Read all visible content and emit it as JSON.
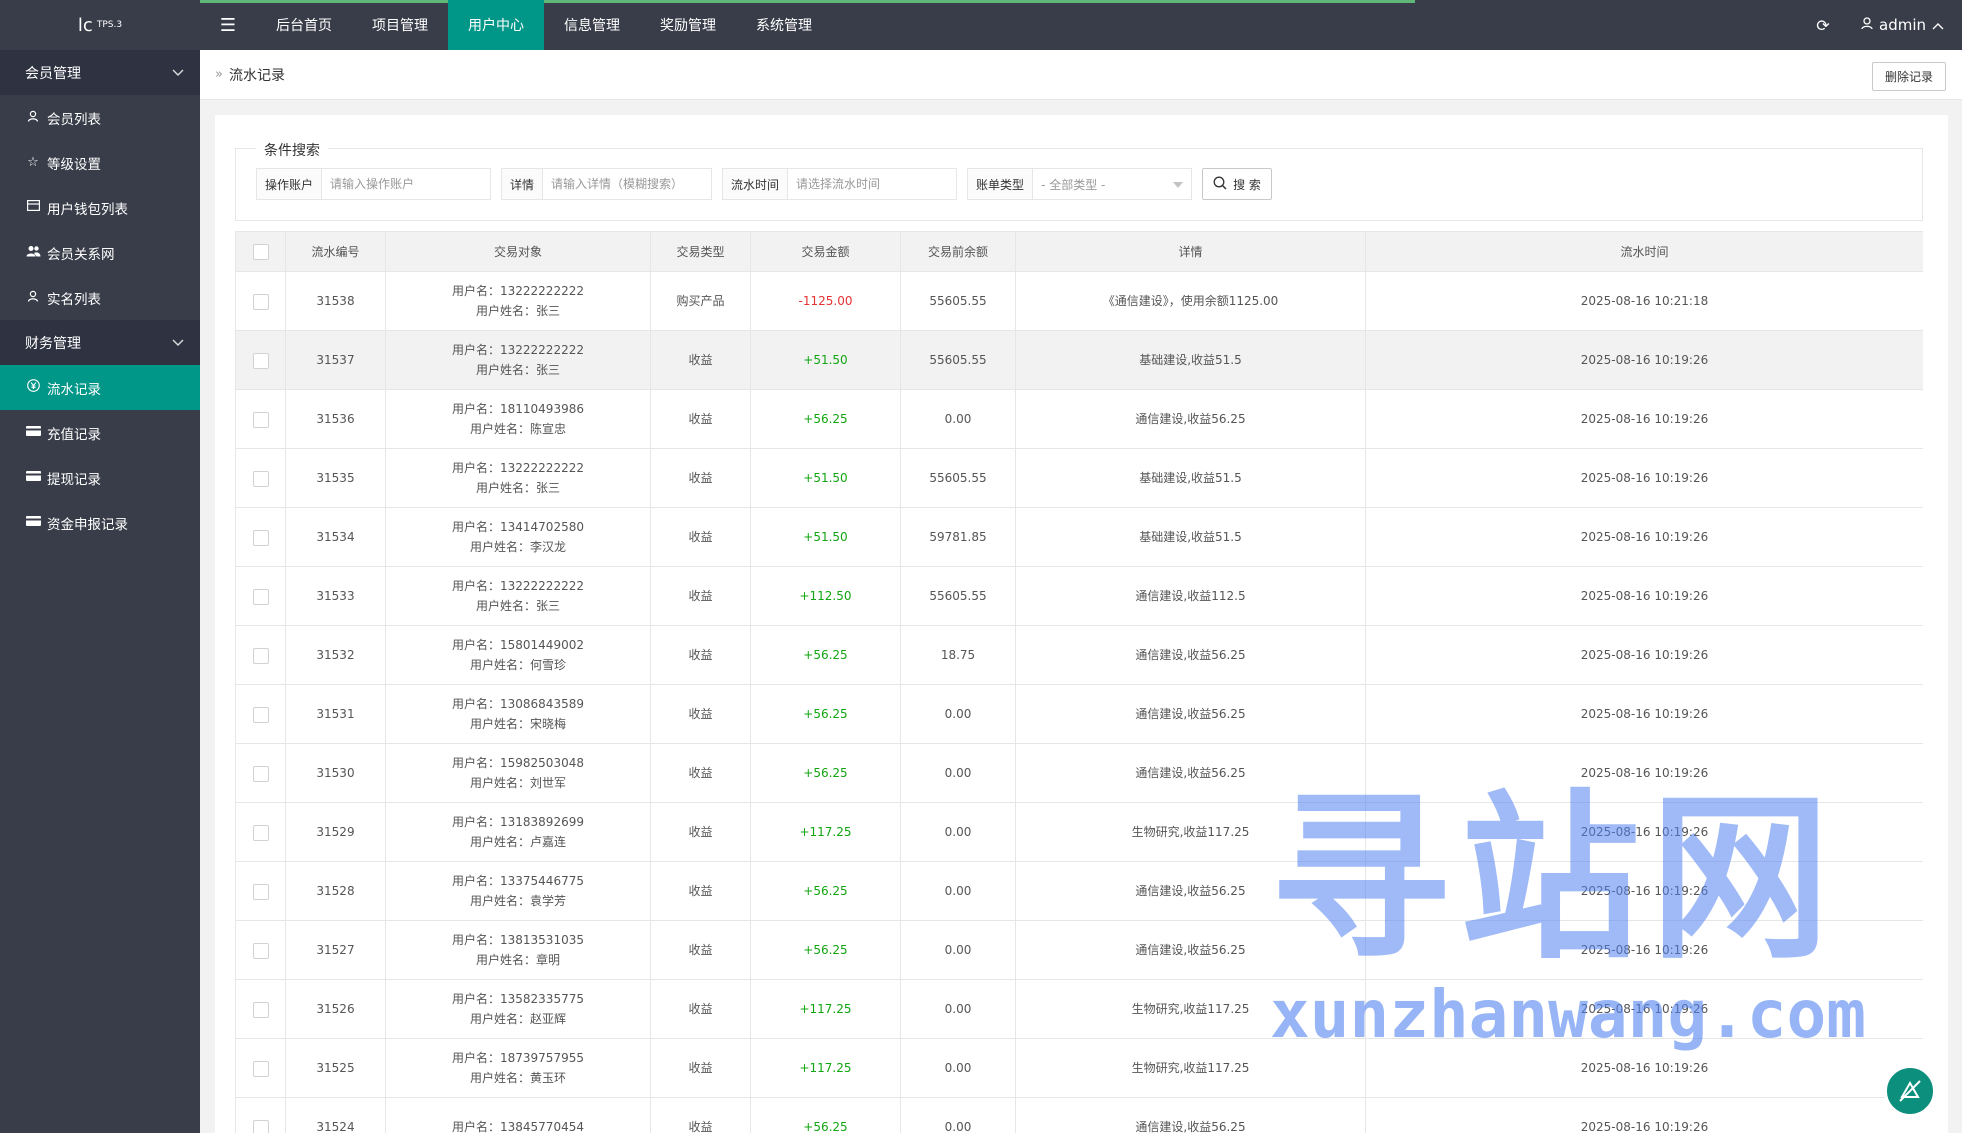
{
  "app": {
    "logo_text": "lc",
    "logo_version": "TPS.3",
    "admin_label": "admin"
  },
  "topnav": [
    {
      "label": "后台首页",
      "active": false
    },
    {
      "label": "项目管理",
      "active": false
    },
    {
      "label": "用户中心",
      "active": true
    },
    {
      "label": "信息管理",
      "active": false
    },
    {
      "label": "奖励管理",
      "active": false
    },
    {
      "label": "系统管理",
      "active": false
    }
  ],
  "sidebar": {
    "group1": "会员管理",
    "group1_items": [
      {
        "label": "会员列表",
        "icon": "user-icon"
      },
      {
        "label": "等级设置",
        "icon": "star-icon"
      },
      {
        "label": "用户钱包列表",
        "icon": "wallet-icon"
      },
      {
        "label": "会员关系网",
        "icon": "users-icon"
      },
      {
        "label": "实名列表",
        "icon": "user-icon"
      }
    ],
    "group2": "财务管理",
    "group2_items": [
      {
        "label": "流水记录",
        "icon": "yen-icon",
        "active": true
      },
      {
        "label": "充值记录",
        "icon": "card-icon"
      },
      {
        "label": "提现记录",
        "icon": "card-icon"
      },
      {
        "label": "资金申报记录",
        "icon": "card-icon"
      }
    ]
  },
  "breadcrumb": {
    "current": "流水记录",
    "delete_label": "删除记录"
  },
  "search": {
    "legend": "条件搜索",
    "account_label": "操作账户",
    "account_placeholder": "请输入操作账户",
    "detail_label": "详情",
    "detail_placeholder": "请输入详情（模糊搜索）",
    "time_label": "流水时间",
    "time_placeholder": "请选择流水时间",
    "type_label": "账单类型",
    "type_value": "- 全部类型 -",
    "button_label": "搜 索"
  },
  "table": {
    "headers": [
      "流水编号",
      "交易对象",
      "交易类型",
      "交易金额",
      "交易前余额",
      "详情",
      "流水时间"
    ],
    "rows": [
      {
        "id": "31538",
        "user": "用户名：13222222222",
        "name": "用户姓名：张三",
        "type": "购买产品",
        "amount": "-1125.00",
        "neg": true,
        "before": "55605.55",
        "detail": "《通信建设》，使用余额1125.00",
        "time": "2025-08-16 10:21:18"
      },
      {
        "id": "31537",
        "user": "用户名：13222222222",
        "name": "用户姓名：张三",
        "type": "收益",
        "amount": "+51.50",
        "neg": false,
        "before": "55605.55",
        "detail": "基础建设,收益51.5",
        "time": "2025-08-16 10:19:26"
      },
      {
        "id": "31536",
        "user": "用户名：18110493986",
        "name": "用户姓名：陈宣忠",
        "type": "收益",
        "amount": "+56.25",
        "neg": false,
        "before": "0.00",
        "detail": "通信建设,收益56.25",
        "time": "2025-08-16 10:19:26"
      },
      {
        "id": "31535",
        "user": "用户名：13222222222",
        "name": "用户姓名：张三",
        "type": "收益",
        "amount": "+51.50",
        "neg": false,
        "before": "55605.55",
        "detail": "基础建设,收益51.5",
        "time": "2025-08-16 10:19:26"
      },
      {
        "id": "31534",
        "user": "用户名：13414702580",
        "name": "用户姓名：李汉龙",
        "type": "收益",
        "amount": "+51.50",
        "neg": false,
        "before": "59781.85",
        "detail": "基础建设,收益51.5",
        "time": "2025-08-16 10:19:26"
      },
      {
        "id": "31533",
        "user": "用户名：13222222222",
        "name": "用户姓名：张三",
        "type": "收益",
        "amount": "+112.50",
        "neg": false,
        "before": "55605.55",
        "detail": "通信建设,收益112.5",
        "time": "2025-08-16 10:19:26"
      },
      {
        "id": "31532",
        "user": "用户名：15801449002",
        "name": "用户姓名：何雪珍",
        "type": "收益",
        "amount": "+56.25",
        "neg": false,
        "before": "18.75",
        "detail": "通信建设,收益56.25",
        "time": "2025-08-16 10:19:26"
      },
      {
        "id": "31531",
        "user": "用户名：13086843589",
        "name": "用户姓名：宋晓梅",
        "type": "收益",
        "amount": "+56.25",
        "neg": false,
        "before": "0.00",
        "detail": "通信建设,收益56.25",
        "time": "2025-08-16 10:19:26"
      },
      {
        "id": "31530",
        "user": "用户名：15982503048",
        "name": "用户姓名：刘世军",
        "type": "收益",
        "amount": "+56.25",
        "neg": false,
        "before": "0.00",
        "detail": "通信建设,收益56.25",
        "time": "2025-08-16 10:19:26"
      },
      {
        "id": "31529",
        "user": "用户名：13183892699",
        "name": "用户姓名：卢嘉连",
        "type": "收益",
        "amount": "+117.25",
        "neg": false,
        "before": "0.00",
        "detail": "生物研究,收益117.25",
        "time": "2025-08-16 10:19:26"
      },
      {
        "id": "31528",
        "user": "用户名：13375446775",
        "name": "用户姓名：袁学芳",
        "type": "收益",
        "amount": "+56.25",
        "neg": false,
        "before": "0.00",
        "detail": "通信建设,收益56.25",
        "time": "2025-08-16 10:19:26"
      },
      {
        "id": "31527",
        "user": "用户名：13813531035",
        "name": "用户姓名：章明",
        "type": "收益",
        "amount": "+56.25",
        "neg": false,
        "before": "0.00",
        "detail": "通信建设,收益56.25",
        "time": "2025-08-16 10:19:26"
      },
      {
        "id": "31526",
        "user": "用户名：13582335775",
        "name": "用户姓名：赵亚辉",
        "type": "收益",
        "amount": "+117.25",
        "neg": false,
        "before": "0.00",
        "detail": "生物研究,收益117.25",
        "time": "2025-08-16 10:19:26"
      },
      {
        "id": "31525",
        "user": "用户名：18739757955",
        "name": "用户姓名：黄玉环",
        "type": "收益",
        "amount": "+117.25",
        "neg": false,
        "before": "0.00",
        "detail": "生物研究,收益117.25",
        "time": "2025-08-16 10:19:26"
      },
      {
        "id": "31524",
        "user": "用户名：13845770454",
        "name": "",
        "type": "收益",
        "amount": "+56.25",
        "neg": false,
        "before": "0.00",
        "detail": "通信建设,收益56.25",
        "time": "2025-08-16 10:19:26"
      }
    ]
  },
  "watermark": {
    "cn": "寻站网",
    "en": "xunzhanwang.com"
  },
  "colors": {
    "header_bg": "#393d49",
    "accent": "#009688",
    "positive": "#11a511",
    "negative": "#e53333"
  }
}
